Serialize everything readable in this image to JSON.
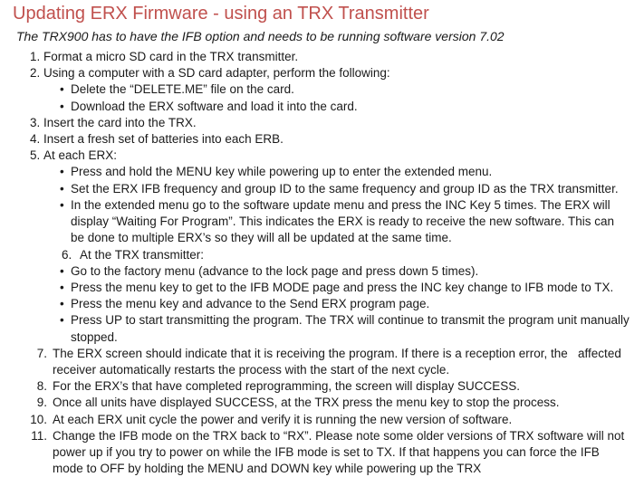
{
  "title": "Updating ERX Firmware - using an TRX Transmitter",
  "subtitle": "The TRX900 has to have the IFB option and needs to be running software version 7.02",
  "steps_1_5": [
    "Format a micro SD card in the TRX transmitter.",
    "Using a computer with a SD card adapter, perform the following:",
    "Insert the card into the TRX.",
    "Insert a fresh set of batteries into each ERB.",
    "At each ERX:"
  ],
  "step2_sub": [
    "Delete the “DELETE.ME” file on the card.",
    "Download the ERX software and load it into the card."
  ],
  "step5_sub": [
    "Press and hold the MENU key while powering up to enter the extended menu.",
    "Set the ERX IFB frequency and group ID to the same frequency and group ID as the TRX transmitter.",
    "In the extended menu go to the software update menu and press the INC Key 5 times. The ERX will display “Waiting For Program”. This indicates the ERX is ready to receive the new software. This can be done to multiple ERX’s so they will all be updated at the same time."
  ],
  "nested6_label": "At the TRX transmitter:",
  "nested6_sub": [
    "Go to the factory menu (advance to the lock page and press down 5 times).",
    "Press the menu key to get to the IFB MODE page and press the INC key change to IFB mode to TX.",
    "Press the menu key and advance to the Send ERX program page.",
    "Press UP to start transmitting the program. The TRX will continue to transmit the program unit manually stopped."
  ],
  "steps_7_11": [
    "The ERX screen should indicate that it is receiving the program. If there is a reception error, the   affected receiver automatically restarts the process with the start of the next cycle.",
    "For the ERX’s that have completed reprogramming, the screen will display SUCCESS.",
    "Once all units have displayed SUCCESS, at the TRX press the menu key to stop the process.",
    "At each ERX unit cycle the power and verify it is running the new version of software.",
    "Change the IFB mode on the TRX back to “RX”. Please note some older versions of TRX software will not power up if you try to power on while the IFB mode is set to TX. If that happens you can force the IFB mode to OFF by holding the MENU and DOWN key while powering up the TRX"
  ]
}
